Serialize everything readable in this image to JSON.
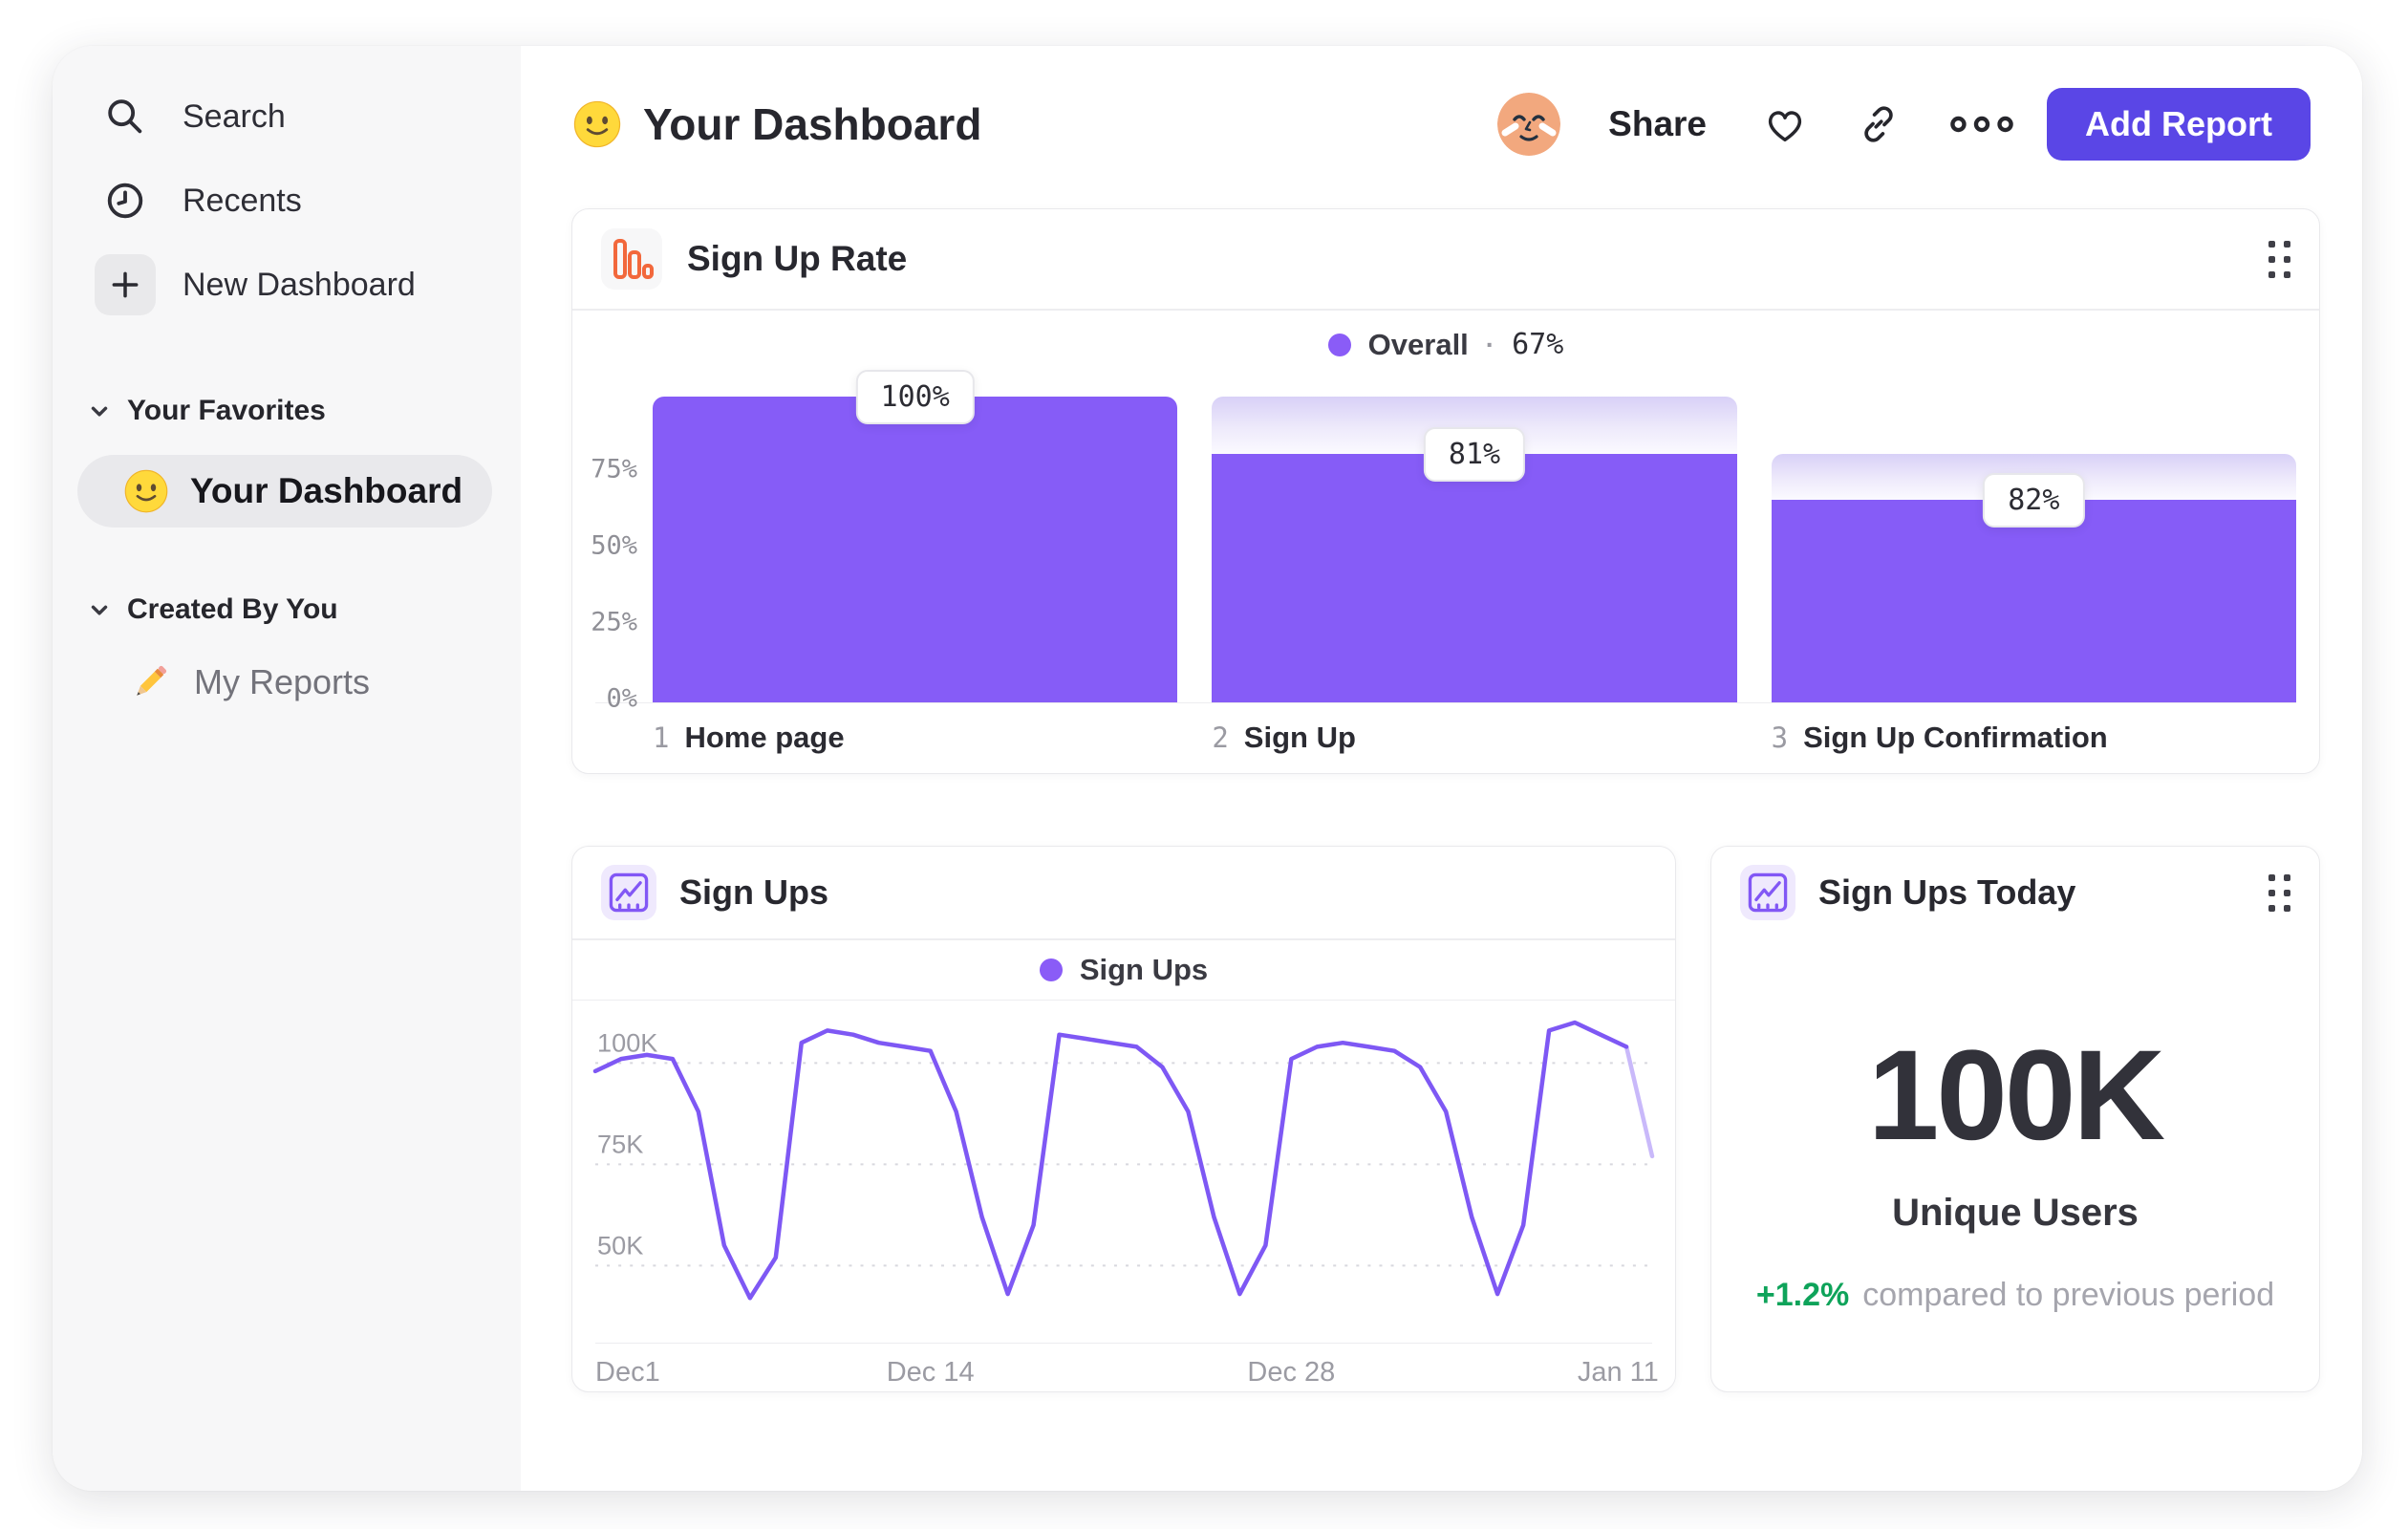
{
  "colors": {
    "accent_purple": "#865CF7",
    "button_indigo": "#5A46E6",
    "funnel_icon_orange": "#F2683C",
    "delta_green": "#0EA35A"
  },
  "sidebar": {
    "nav": [
      {
        "icon": "search-icon",
        "label": "Search"
      },
      {
        "icon": "clock-icon",
        "label": "Recents"
      },
      {
        "icon": "plus-icon",
        "label": "New Dashboard"
      }
    ],
    "sections": [
      {
        "title": "Your Favorites",
        "items": [
          {
            "icon": "smiley-emoji",
            "label": "Your Dashboard",
            "selected": true
          }
        ]
      },
      {
        "title": "Created By You",
        "items": [
          {
            "icon": "pencil-emoji",
            "label": "My Reports",
            "selected": false
          }
        ]
      }
    ]
  },
  "header": {
    "title_emoji": "smiley-emoji",
    "title": "Your Dashboard",
    "avatar": "face-avatar",
    "share_label": "Share",
    "action_icons": [
      "heart-icon",
      "link-icon",
      "ellipsis-icon"
    ],
    "add_report_label": "Add Report"
  },
  "chart_data": [
    {
      "type": "bar",
      "variant": "funnel",
      "title": "Sign Up Rate",
      "legend": {
        "series": "Overall",
        "separator": "·",
        "value": "67%"
      },
      "y_ticks": [
        "75%",
        "50%",
        "25%",
        "0%"
      ],
      "y_tick_values": [
        75,
        50,
        25,
        0
      ],
      "ylim": [
        0,
        100
      ],
      "grid": false,
      "categories": [
        "Home page",
        "Sign Up",
        "Sign Up Confirmation"
      ],
      "steps": [
        {
          "index": "1",
          "label": "Home page",
          "badge": "100%",
          "total_pct": 100,
          "solid_pct": 100
        },
        {
          "index": "2",
          "label": "Sign Up",
          "badge": "81%",
          "total_pct": 100,
          "solid_pct": 81
        },
        {
          "index": "3",
          "label": "Sign Up Confirmation",
          "badge": "82%",
          "total_pct": 81,
          "solid_pct": 66
        }
      ]
    },
    {
      "type": "line",
      "title": "Sign Ups",
      "legend": "Sign Ups",
      "x_tick_labels": [
        "Dec1",
        "Dec 14",
        "Dec 28",
        "Jan 11"
      ],
      "x_tick_days": [
        0,
        13,
        27,
        41
      ],
      "y_ticks": [
        {
          "label": "100K",
          "value": 100
        },
        {
          "label": "75K",
          "value": 75
        },
        {
          "label": "50K",
          "value": 50
        }
      ],
      "ylim": [
        31,
        114
      ],
      "grid": "dashed-horizontal",
      "legend_position": "top-center",
      "values_thousands": [
        98,
        101,
        102,
        101,
        88,
        55,
        42,
        52,
        105,
        108,
        107,
        105,
        104,
        103,
        88,
        62,
        43,
        60,
        107,
        106,
        105,
        104,
        99,
        88,
        62,
        43,
        55,
        101,
        104,
        105,
        104,
        103,
        99,
        88,
        62,
        43,
        60,
        108,
        110,
        107,
        104,
        77
      ],
      "faded_from_index": 40
    },
    {
      "type": "metric",
      "title": "Sign Ups Today",
      "value": "100K",
      "value_label": "Unique Users",
      "delta": "+1.2%",
      "delta_direction": "up",
      "delta_note": "compared to previous period"
    }
  ]
}
